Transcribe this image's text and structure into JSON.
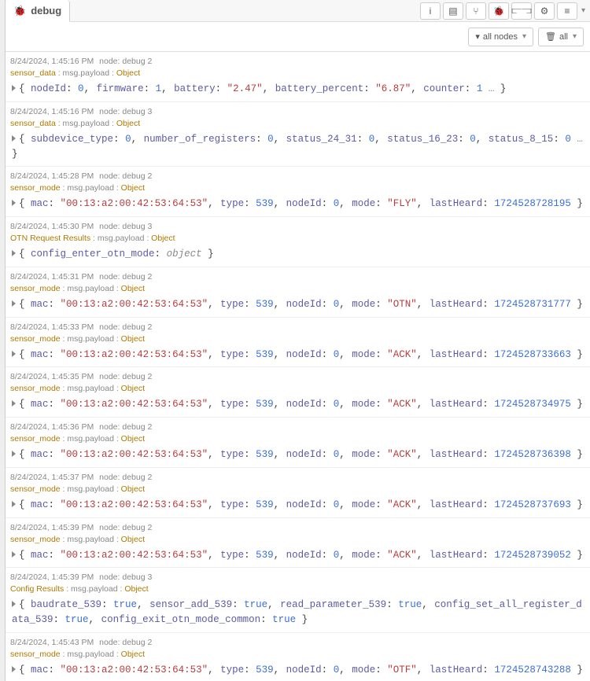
{
  "header": {
    "tab_label": "debug",
    "filter_label": "all nodes",
    "clear_label": "all"
  },
  "labels": {
    "node_prefix": "node:",
    "msg_payload": "msg.payload",
    "object_suffix": "Object",
    "bool_true": "true",
    "object_italic": "object"
  },
  "messages": [
    {
      "ts": "8/24/2024, 1:45:16 PM",
      "node": "debug 2",
      "topic": "sensor_data",
      "kv": [
        {
          "k": "nodeId",
          "t": "num",
          "v": "0"
        },
        {
          "k": "firmware",
          "t": "num",
          "v": "1"
        },
        {
          "k": "battery",
          "t": "str",
          "v": "\"2.47\""
        },
        {
          "k": "battery_percent",
          "t": "str",
          "v": "\"6.87\""
        },
        {
          "k": "counter",
          "t": "num",
          "v": "1"
        }
      ],
      "trailing_ellipsis": true
    },
    {
      "ts": "8/24/2024, 1:45:16 PM",
      "node": "debug 3",
      "topic": "sensor_data",
      "kv": [
        {
          "k": "subdevice_type",
          "t": "num",
          "v": "0"
        },
        {
          "k": "number_of_registers",
          "t": "num",
          "v": "0"
        },
        {
          "k": "status_24_31",
          "t": "num",
          "v": "0"
        },
        {
          "k": "status_16_23",
          "t": "num",
          "v": "0"
        },
        {
          "k": "status_8_15",
          "t": "num",
          "v": "0"
        }
      ],
      "trailing_ellipsis": true
    },
    {
      "ts": "8/24/2024, 1:45:28 PM",
      "node": "debug 2",
      "topic": "sensor_mode",
      "kv": [
        {
          "k": "mac",
          "t": "str",
          "v": "\"00:13:a2:00:42:53:64:53\""
        },
        {
          "k": "type",
          "t": "num",
          "v": "539"
        },
        {
          "k": "nodeId",
          "t": "num",
          "v": "0"
        },
        {
          "k": "mode",
          "t": "str",
          "v": "\"FLY\""
        },
        {
          "k": "lastHeard",
          "t": "num",
          "v": "1724528728195"
        }
      ]
    },
    {
      "ts": "8/24/2024, 1:45:30 PM",
      "node": "debug 3",
      "topic": "OTN Request Results",
      "kv": [
        {
          "k": "config_enter_otn_mode",
          "t": "obj",
          "v": "object"
        }
      ]
    },
    {
      "ts": "8/24/2024, 1:45:31 PM",
      "node": "debug 2",
      "topic": "sensor_mode",
      "kv": [
        {
          "k": "mac",
          "t": "str",
          "v": "\"00:13:a2:00:42:53:64:53\""
        },
        {
          "k": "type",
          "t": "num",
          "v": "539"
        },
        {
          "k": "nodeId",
          "t": "num",
          "v": "0"
        },
        {
          "k": "mode",
          "t": "str",
          "v": "\"OTN\""
        },
        {
          "k": "lastHeard",
          "t": "num",
          "v": "1724528731777"
        }
      ]
    },
    {
      "ts": "8/24/2024, 1:45:33 PM",
      "node": "debug 2",
      "topic": "sensor_mode",
      "kv": [
        {
          "k": "mac",
          "t": "str",
          "v": "\"00:13:a2:00:42:53:64:53\""
        },
        {
          "k": "type",
          "t": "num",
          "v": "539"
        },
        {
          "k": "nodeId",
          "t": "num",
          "v": "0"
        },
        {
          "k": "mode",
          "t": "str",
          "v": "\"ACK\""
        },
        {
          "k": "lastHeard",
          "t": "num",
          "v": "1724528733663"
        }
      ]
    },
    {
      "ts": "8/24/2024, 1:45:35 PM",
      "node": "debug 2",
      "topic": "sensor_mode",
      "kv": [
        {
          "k": "mac",
          "t": "str",
          "v": "\"00:13:a2:00:42:53:64:53\""
        },
        {
          "k": "type",
          "t": "num",
          "v": "539"
        },
        {
          "k": "nodeId",
          "t": "num",
          "v": "0"
        },
        {
          "k": "mode",
          "t": "str",
          "v": "\"ACK\""
        },
        {
          "k": "lastHeard",
          "t": "num",
          "v": "1724528734975"
        }
      ]
    },
    {
      "ts": "8/24/2024, 1:45:36 PM",
      "node": "debug 2",
      "topic": "sensor_mode",
      "kv": [
        {
          "k": "mac",
          "t": "str",
          "v": "\"00:13:a2:00:42:53:64:53\""
        },
        {
          "k": "type",
          "t": "num",
          "v": "539"
        },
        {
          "k": "nodeId",
          "t": "num",
          "v": "0"
        },
        {
          "k": "mode",
          "t": "str",
          "v": "\"ACK\""
        },
        {
          "k": "lastHeard",
          "t": "num",
          "v": "1724528736398"
        }
      ]
    },
    {
      "ts": "8/24/2024, 1:45:37 PM",
      "node": "debug 2",
      "topic": "sensor_mode",
      "kv": [
        {
          "k": "mac",
          "t": "str",
          "v": "\"00:13:a2:00:42:53:64:53\""
        },
        {
          "k": "type",
          "t": "num",
          "v": "539"
        },
        {
          "k": "nodeId",
          "t": "num",
          "v": "0"
        },
        {
          "k": "mode",
          "t": "str",
          "v": "\"ACK\""
        },
        {
          "k": "lastHeard",
          "t": "num",
          "v": "1724528737693"
        }
      ]
    },
    {
      "ts": "8/24/2024, 1:45:39 PM",
      "node": "debug 2",
      "topic": "sensor_mode",
      "kv": [
        {
          "k": "mac",
          "t": "str",
          "v": "\"00:13:a2:00:42:53:64:53\""
        },
        {
          "k": "type",
          "t": "num",
          "v": "539"
        },
        {
          "k": "nodeId",
          "t": "num",
          "v": "0"
        },
        {
          "k": "mode",
          "t": "str",
          "v": "\"ACK\""
        },
        {
          "k": "lastHeard",
          "t": "num",
          "v": "1724528739052"
        }
      ]
    },
    {
      "ts": "8/24/2024, 1:45:39 PM",
      "node": "debug 3",
      "topic": "Config Results",
      "kv": [
        {
          "k": "baudrate_539",
          "t": "bool",
          "v": "true"
        },
        {
          "k": "sensor_add_539",
          "t": "bool",
          "v": "true"
        },
        {
          "k": "read_parameter_539",
          "t": "bool",
          "v": "true"
        },
        {
          "k": "config_set_all_register_data_539",
          "t": "bool",
          "v": "true"
        },
        {
          "k": "config_exit_otn_mode_common",
          "t": "bool",
          "v": "true"
        }
      ]
    },
    {
      "ts": "8/24/2024, 1:45:43 PM",
      "node": "debug 2",
      "topic": "sensor_mode",
      "kv": [
        {
          "k": "mac",
          "t": "str",
          "v": "\"00:13:a2:00:42:53:64:53\""
        },
        {
          "k": "type",
          "t": "num",
          "v": "539"
        },
        {
          "k": "nodeId",
          "t": "num",
          "v": "0"
        },
        {
          "k": "mode",
          "t": "str",
          "v": "\"OTF\""
        },
        {
          "k": "lastHeard",
          "t": "num",
          "v": "1724528743288"
        }
      ]
    }
  ]
}
